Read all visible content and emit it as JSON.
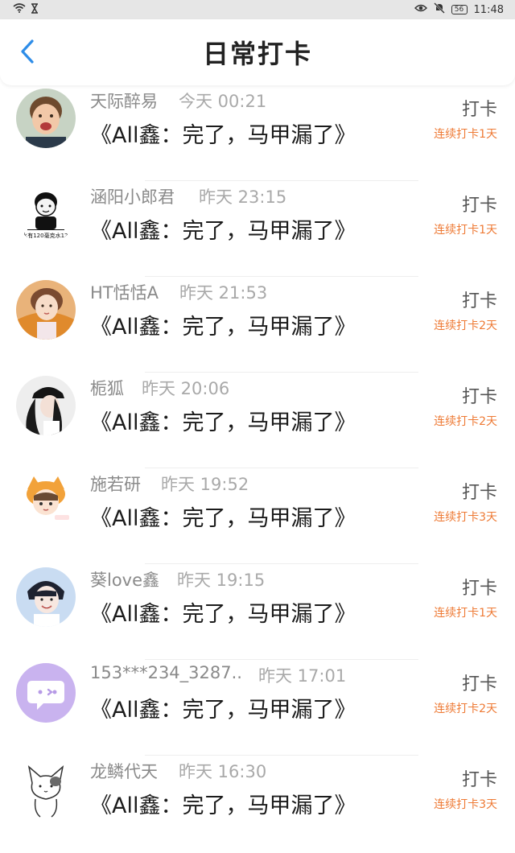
{
  "status_bar": {
    "battery": "56",
    "time": "11:48"
  },
  "header": {
    "title": "日常打卡"
  },
  "colors": {
    "accent_back": "#2e8de8",
    "streak": "#ee7a35"
  },
  "entries": [
    {
      "name": "天际醉易",
      "time": "今天 00:21",
      "book": "《All鑫：完了，马甲漏了》",
      "action": "打卡",
      "streak": "连续打卡1天"
    },
    {
      "name": "涵阳小郎君",
      "time": "昨天 23:15",
      "book": "《All鑫：完了，马甲漏了》",
      "action": "打卡",
      "streak": "连续打卡1天",
      "avatar_caption": "\"水有120毫克水12\""
    },
    {
      "name": "HT恬恬A",
      "time": "昨天 21:53",
      "book": "《All鑫：完了，马甲漏了》",
      "action": "打卡",
      "streak": "连续打卡2天"
    },
    {
      "name": "栀狐",
      "time": "昨天 20:06",
      "book": "《All鑫：完了，马甲漏了》",
      "action": "打卡",
      "streak": "连续打卡2天"
    },
    {
      "name": "施若研",
      "time": "昨天 19:52",
      "book": "《All鑫：完了，马甲漏了》",
      "action": "打卡",
      "streak": "连续打卡3天"
    },
    {
      "name": "葵love鑫",
      "time": "昨天 19:15",
      "book": "《All鑫：完了，马甲漏了》",
      "action": "打卡",
      "streak": "连续打卡1天"
    },
    {
      "name": "153***234_3287..",
      "time": "昨天 17:01",
      "book": "《All鑫：完了，马甲漏了》",
      "action": "打卡",
      "streak": "连续打卡2天"
    },
    {
      "name": "龙鳞代天",
      "time": "昨天 16:30",
      "book": "《All鑫：完了，马甲漏了》",
      "action": "打卡",
      "streak": "连续打卡3天"
    }
  ]
}
